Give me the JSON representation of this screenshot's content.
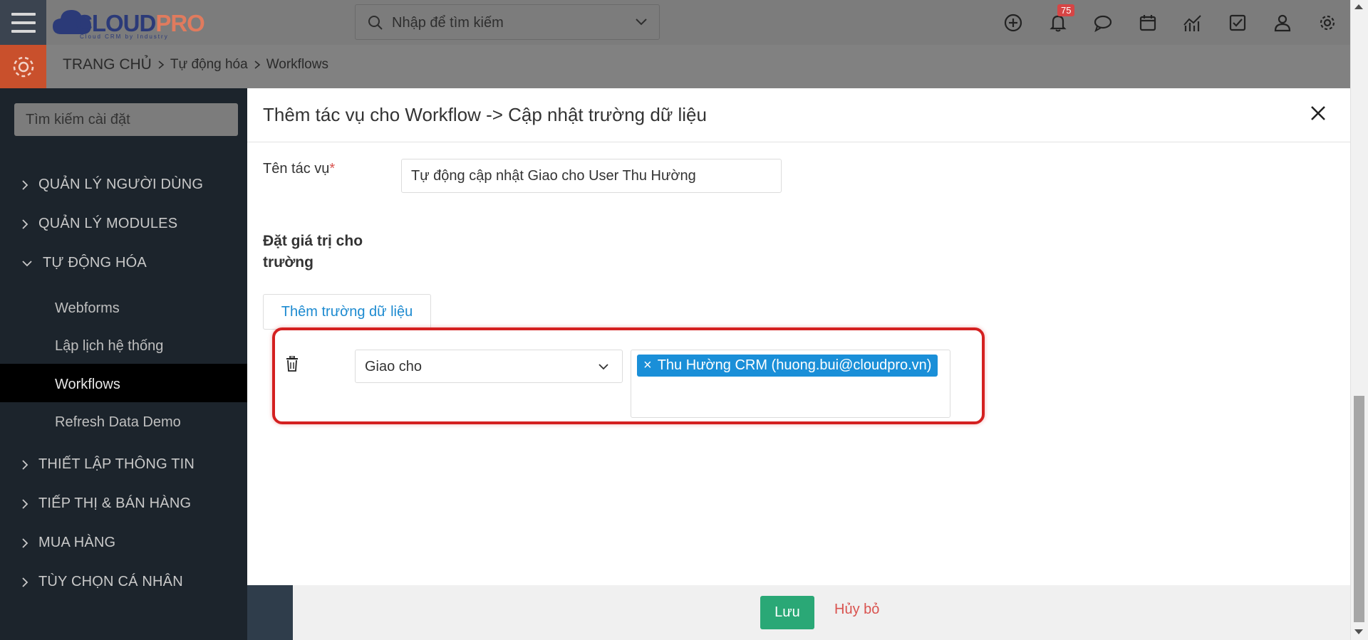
{
  "topbar": {
    "logo": {
      "main": "CLOUD",
      "accent": "PRO",
      "tagline": "Cloud CRM by Industry"
    },
    "search_placeholder": "Nhập để tìm kiếm",
    "notification_count": "75",
    "icons": [
      "plus-circle-icon",
      "bell-icon",
      "chat-icon",
      "calendar-icon",
      "chart-icon",
      "task-check-icon",
      "user-icon",
      "gear-icon"
    ]
  },
  "breadcrumb": {
    "home": "TRANG CHỦ",
    "level1": "Tự động hóa",
    "level2": "Workflows"
  },
  "sidebar": {
    "search_placeholder": "Tìm kiếm cài đặt",
    "items": [
      {
        "label": "QUẢN LÝ NGƯỜI DÙNG"
      },
      {
        "label": "QUẢN LÝ MODULES"
      },
      {
        "label": "TỰ ĐỘNG HÓA"
      },
      {
        "label": "THIẾT LẬP THÔNG TIN"
      },
      {
        "label": "TIẾP THỊ & BÁN HÀNG"
      },
      {
        "label": "MUA HÀNG"
      },
      {
        "label": "TÙY CHỌN CÁ NHÂN"
      }
    ],
    "sub_items": [
      {
        "label": "Webforms"
      },
      {
        "label": "Lập lịch hệ thống"
      },
      {
        "label": "Workflows"
      },
      {
        "label": "Refresh Data Demo"
      }
    ]
  },
  "modal": {
    "title": "Thêm tác vụ cho Workflow -> Cập nhật trường dữ liệu",
    "task_name_label": "Tên tác vụ",
    "required_mark": "*",
    "task_name_value": "Tự động cập nhật Giao cho User Thu Hường",
    "section_title": "Đặt giá trị cho trường",
    "add_field_label": "Thêm trường dữ liệu",
    "field_select_value": "Giao cho",
    "selected_tag": "Thu Hường CRM (huong.bui@cloudpro.vn)",
    "tag_remove": "×"
  },
  "footer": {
    "save_label": "Lưu",
    "cancel_label": "Hủy bỏ"
  },
  "colors": {
    "accent_blue": "#1a8fd8",
    "save_green": "#2aa876",
    "danger_red": "#d9534f",
    "highlight_red": "#d42020",
    "sidebar_bg": "#1c242c"
  }
}
